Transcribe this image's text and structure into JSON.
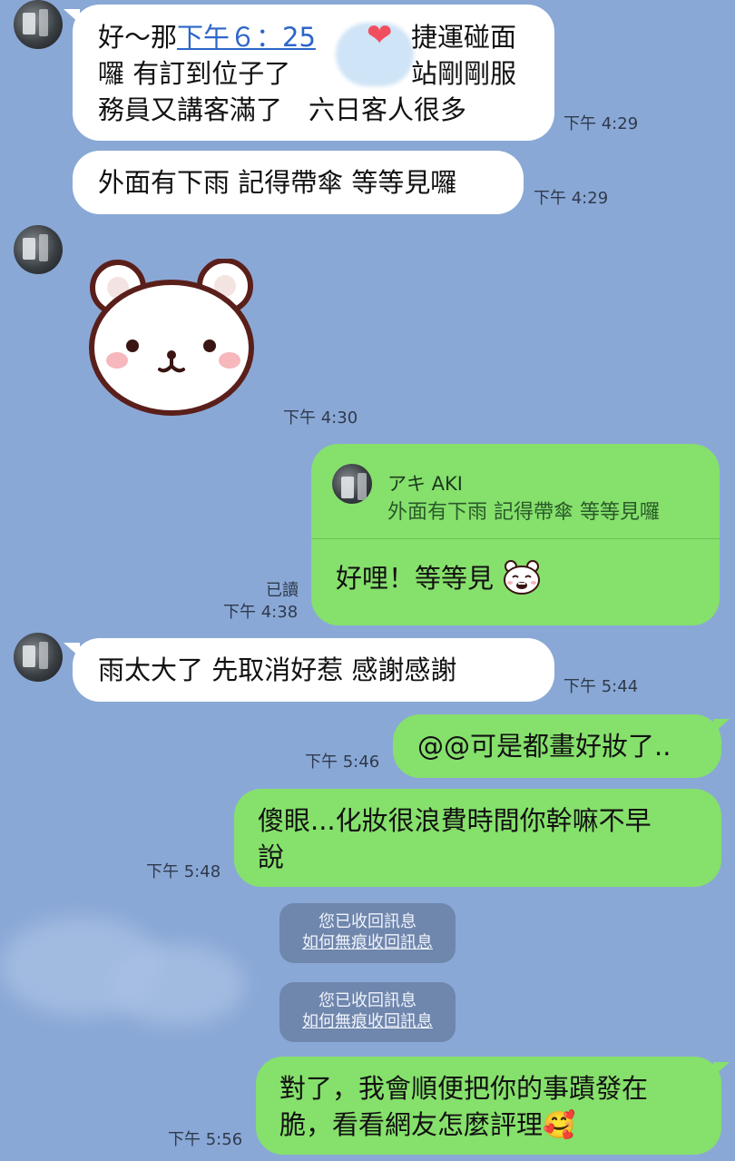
{
  "messages": {
    "m1": {
      "line1_pre": "好～那",
      "line1_link": "下午６：25",
      "line1_post": "捷運碰面",
      "line2_pre": "囉 有訂到位子了",
      "line2_post": "站剛剛服",
      "line3": "務員又講客滿了　六日客人很多",
      "time": "下午 4:29"
    },
    "m2": {
      "text": "外面有下雨 記得帶傘 等等見囉",
      "time": "下午 4:29"
    },
    "m3": {
      "sticker": "white-bear-sticker",
      "time": "下午 4:30"
    },
    "m4": {
      "quote_name": "アキ AKI",
      "quote_text": "外面有下雨 記得帶傘 等等見囉",
      "text": "好哩！等等見",
      "read": "已讀",
      "time": "下午 4:38"
    },
    "m5": {
      "text": "雨太大了 先取消好惹 感謝感謝",
      "time": "下午 5:44"
    },
    "m6": {
      "text": "@@可是都畫好妝了..",
      "time": "下午 5:46"
    },
    "m7": {
      "line1": "傻眼...化妝很浪費時間你幹嘛不早",
      "line2": "說",
      "time": "下午 5:48"
    },
    "sys1": {
      "line1": "您已收回訊息",
      "line2": "如何無痕收回訊息"
    },
    "sys2": {
      "line1": "您已收回訊息",
      "line2": "如何無痕收回訊息"
    },
    "m8": {
      "line1": "對了，我會順便把你的事蹟發在",
      "line2": "脆，看看網友怎麼評理",
      "emoji": "🥰",
      "time": "下午 5:56"
    }
  },
  "colors": {
    "background": "#8aa8d6",
    "incoming": "#ffffff",
    "outgoing": "#86e06c",
    "link": "#2d66c8"
  }
}
